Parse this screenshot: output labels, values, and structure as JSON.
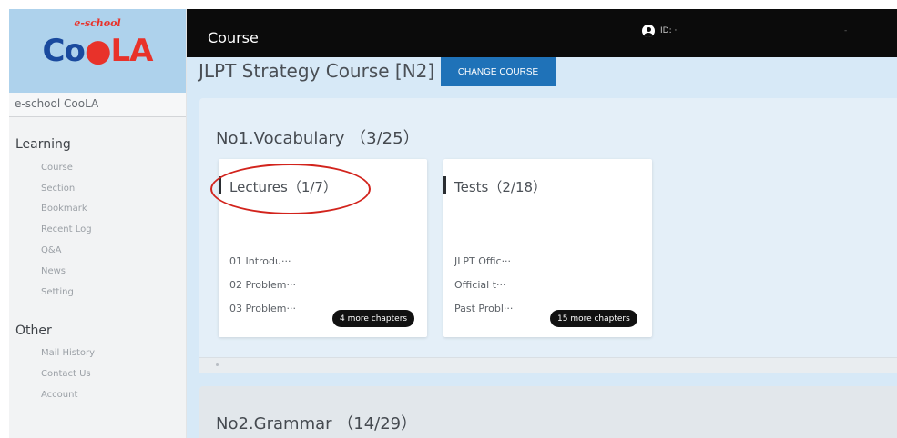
{
  "brand": {
    "logo_small": "e-school",
    "logo_parts": [
      "Co",
      "●",
      "LA"
    ]
  },
  "sidebar": {
    "school_name": "e-school CooLA",
    "learning_header": "Learning",
    "learning_items": [
      "Course",
      "Section",
      "Bookmark",
      "Recent Log",
      "Q&A",
      "News",
      "Setting"
    ],
    "other_header": "Other",
    "other_items": [
      "Mail History",
      "Contact Us",
      "Account"
    ]
  },
  "header": {
    "title": "Course",
    "id_label": "ID: ·",
    "id_tail": "- ."
  },
  "course": {
    "title": "JLPT Strategy Course [N2]",
    "change_button": "CHANGE COURSE"
  },
  "sections": [
    {
      "title": "No1.Vocabulary （3/25）",
      "cards": [
        {
          "title": "Lectures（1/7）",
          "chapters": [
            "01 Introdu···",
            "02 Problem···",
            "03 Problem···"
          ],
          "more": "4 more chapters"
        },
        {
          "title": "Tests（2/18）",
          "chapters": [
            "JLPT Offic···",
            "Official t···",
            "Past Probl···"
          ],
          "more": "15 more chapters"
        }
      ]
    },
    {
      "title": "No2.Grammar （14/29）"
    }
  ],
  "colors": {
    "header_bg": "#0b0b0b",
    "accent_blue": "#1f72b8",
    "highlight_red": "#d2231c",
    "page_bg": "#d7e9f7"
  },
  "icons": [
    "user-icon"
  ]
}
